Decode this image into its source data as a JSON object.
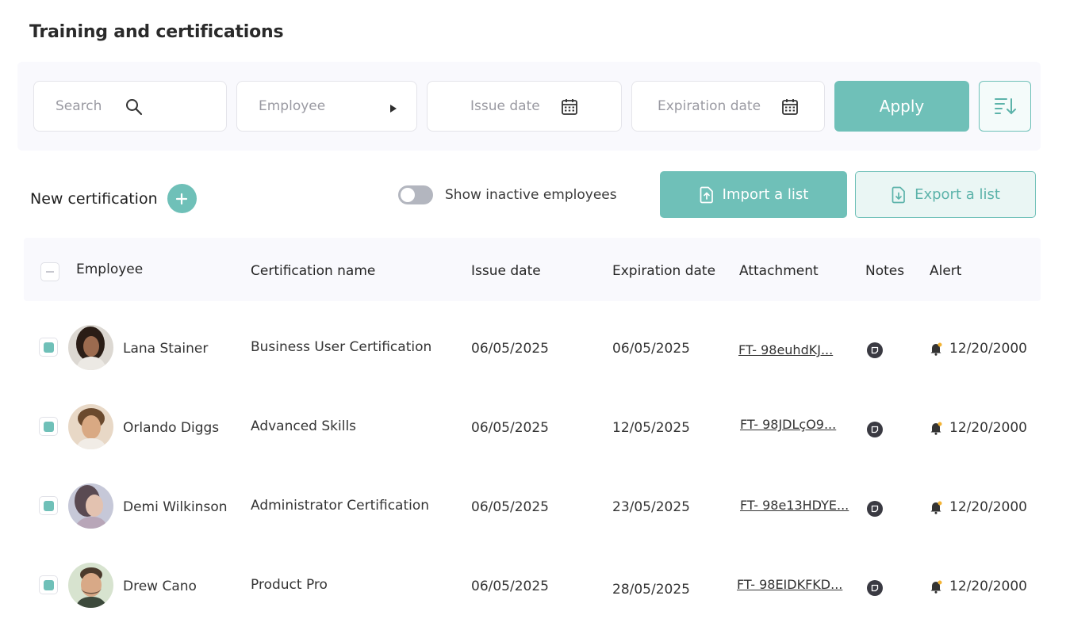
{
  "page": {
    "title": "Training and certifications"
  },
  "filters": {
    "search_placeholder": "Search",
    "employee_placeholder": "Employee",
    "issue_date_placeholder": "Issue date",
    "expiration_date_placeholder": "Expiration date",
    "apply_label": "Apply"
  },
  "toolbar": {
    "new_certification_label": "New certification",
    "show_inactive_label": "Show inactive employees",
    "show_inactive_enabled": false,
    "import_label": "Import a list",
    "export_label": "Export a list"
  },
  "table": {
    "headers": {
      "employee": "Employee",
      "certification_name": "Certification name",
      "issue_date": "Issue date",
      "expiration_date": "Expiration date",
      "attachment": "Attachment",
      "notes": "Notes",
      "alert": "Alert"
    },
    "rows": [
      {
        "employee": "Lana Stainer",
        "certification": "Business User Certification",
        "issue_date": "06/05/2025",
        "expiration_date": "06/05/2025",
        "attachment": "FT- 98euhdKJ...",
        "alert": "12/20/2000",
        "selected": true
      },
      {
        "employee": "Orlando Diggs",
        "certification": "Advanced Skills",
        "issue_date": "06/05/2025",
        "expiration_date": "12/05/2025",
        "attachment": "FT- 98JDLçO9...",
        "alert": "12/20/2000",
        "selected": true
      },
      {
        "employee": "Demi Wilkinson",
        "certification": "Administrator Certification",
        "issue_date": "06/05/2025",
        "expiration_date": "23/05/2025",
        "attachment": "FT- 98e13HDYE...",
        "alert": "12/20/2000",
        "selected": true
      },
      {
        "employee": "Drew Cano",
        "certification": "Product Pro",
        "issue_date": "06/05/2025",
        "expiration_date": "28/05/2025",
        "attachment": "FT- 98EIDKFKD...",
        "alert": "12/20/2000",
        "selected": true
      }
    ]
  },
  "colors": {
    "accent": "#6fc0b8",
    "panel_bg": "#f9f9fd",
    "alert_dot": "#f2b233"
  }
}
